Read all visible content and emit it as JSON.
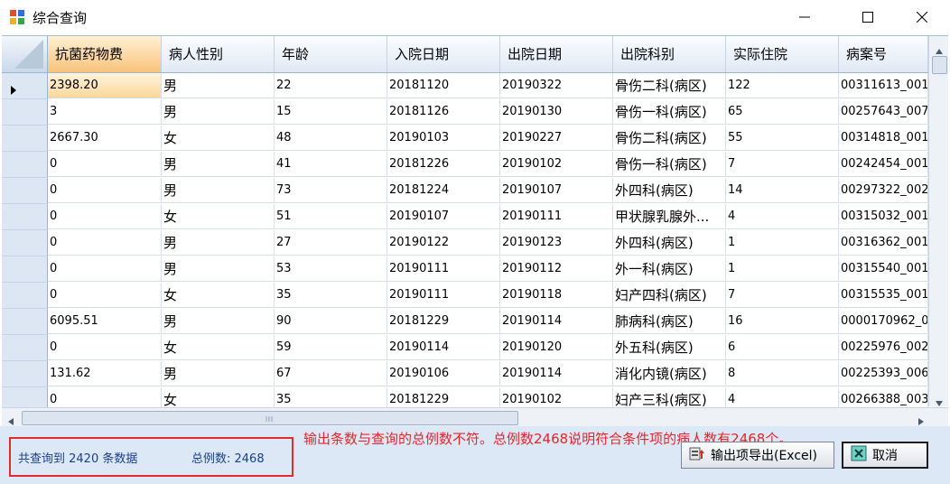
{
  "window": {
    "title": "综合查询",
    "icon": "app-window-icon",
    "controls": [
      "minimize-icon",
      "maximize-icon",
      "close-icon"
    ]
  },
  "grid": {
    "columns": [
      "抗菌药物费",
      "病人性别",
      "年龄",
      "入院日期",
      "出院日期",
      "出院科别",
      "实际住院",
      "病案号"
    ],
    "selected_column": 0,
    "current_row": 0,
    "rows": [
      [
        "2398.20",
        "男",
        "22",
        "20181120",
        "20190322",
        "骨伤二科(病区)",
        "122",
        "00311613_001"
      ],
      [
        "3",
        "男",
        "15",
        "20181126",
        "20190130",
        "骨伤一科(病区)",
        "65",
        "00257643_007"
      ],
      [
        "2667.30",
        "女",
        "48",
        "20190103",
        "20190227",
        "骨伤二科(病区)",
        "55",
        "00314818_001"
      ],
      [
        "0",
        "男",
        "41",
        "20181226",
        "20190102",
        "骨伤一科(病区)",
        "7",
        "00242454_001"
      ],
      [
        "0",
        "男",
        "73",
        "20181224",
        "20190107",
        "外四科(病区)",
        "14",
        "00297322_002"
      ],
      [
        "0",
        "女",
        "51",
        "20190107",
        "20190111",
        "甲状腺乳腺外...",
        "4",
        "00315032_001"
      ],
      [
        "0",
        "男",
        "27",
        "20190122",
        "20190123",
        "外四科(病区)",
        "1",
        "00316362_001"
      ],
      [
        "0",
        "男",
        "53",
        "20190111",
        "20190112",
        "外一科(病区)",
        "1",
        "00315540_001"
      ],
      [
        "0",
        "女",
        "35",
        "20190111",
        "20190118",
        "妇产四科(病区)",
        "7",
        "00315535_001"
      ],
      [
        "6095.51",
        "男",
        "90",
        "20181229",
        "20190114",
        "肺病科(病区)",
        "16",
        "0000170962_00"
      ],
      [
        "0",
        "女",
        "59",
        "20190114",
        "20190120",
        "外五科(病区)",
        "6",
        "00225976_002"
      ],
      [
        "131.62",
        "男",
        "67",
        "20190106",
        "20190114",
        "消化内镜(病区)",
        "8",
        "00225393_006"
      ],
      [
        "0",
        "女",
        "35",
        "20181229",
        "20190102",
        "妇产三科(病区)",
        "4",
        "00266388_003"
      ]
    ]
  },
  "status": {
    "query_count": "共查询到 2420 条数据",
    "total_cases": "总例数: 2468"
  },
  "annotation": "输出条数与查询的总例数不符。总例数2468说明符合条件项的病人数有2468个。",
  "buttons": {
    "export_label": "输出项导出(Excel)",
    "cancel_label": "取消"
  },
  "colors": {
    "selected_cell": "#fbd79b",
    "header_blue": "#dfe9f5",
    "annotation_red": "#e8242a",
    "status_text": "#1b3f8b"
  }
}
